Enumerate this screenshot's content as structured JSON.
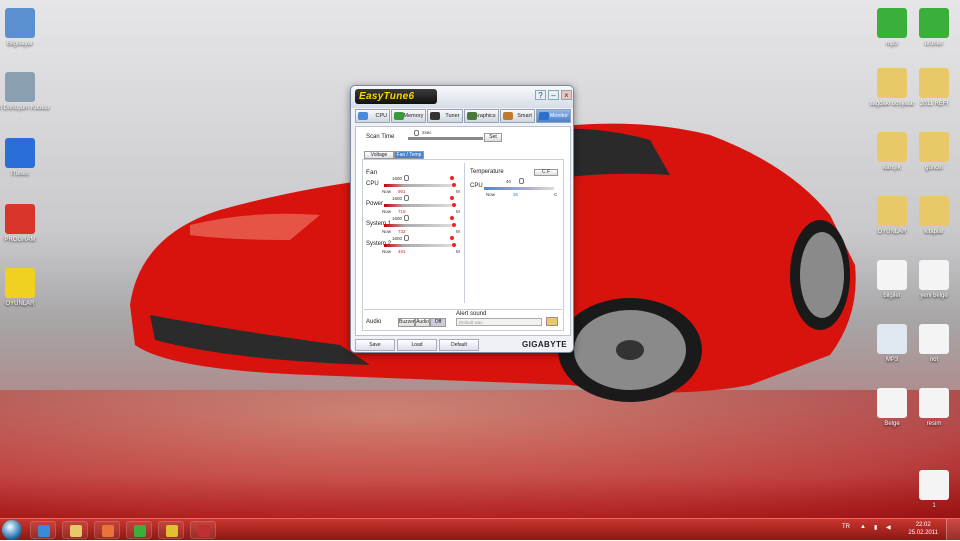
{
  "desktop_icons_left": [
    {
      "name": "computer-icon",
      "label": "Bilgisayar",
      "color": "#5b8fd0"
    },
    {
      "name": "recycle-bin-icon",
      "label": "Geri Dönüşüm Kutusu",
      "color": "#8aa0b0"
    },
    {
      "name": "itunes-icon",
      "label": "iTunes",
      "color": "#2a6fd8"
    },
    {
      "name": "program-icon",
      "label": "PROGRAM",
      "color": "#d9342a"
    },
    {
      "name": "shield-icon",
      "label": "OYUNLAR",
      "color": "#f0d020"
    }
  ],
  "desktop_icons_right": [
    {
      "name": "play-shortcut-icon",
      "label": "mp3",
      "color": "#3ab03a"
    },
    {
      "name": "arrow-shortcut-icon",
      "label": "ürünler",
      "color": "#3ab03a"
    },
    {
      "name": "folder-icon",
      "label": "sağdaki dosyalar",
      "color": "#e8c868"
    },
    {
      "name": "folder-icon",
      "label": "2011 REFİ",
      "color": "#e8c868"
    },
    {
      "name": "folder-icon",
      "label": "karışık",
      "color": "#e8c868"
    },
    {
      "name": "folder-icon",
      "label": "güncel",
      "color": "#e8c868"
    },
    {
      "name": "folder-icon",
      "label": "OYUNLAR",
      "color": "#e8c868"
    },
    {
      "name": "folder-icon",
      "label": "kitaplar",
      "color": "#e8c868"
    },
    {
      "name": "document-icon",
      "label": "bilgiler",
      "color": "#f4f4f4"
    },
    {
      "name": "document-icon",
      "label": "yeni belge",
      "color": "#f4f4f4"
    },
    {
      "name": "mp3-file-icon",
      "label": "MP3",
      "color": "#dfe7f0"
    },
    {
      "name": "document-icon",
      "label": "not",
      "color": "#f4f4f4"
    },
    {
      "name": "document-icon",
      "label": "Belge",
      "color": "#f4f4f4"
    },
    {
      "name": "image-file-icon",
      "label": "resim",
      "color": "#f4f4f4"
    },
    {
      "name": "image-file-icon",
      "label": "1",
      "color": "#f4f4f4"
    }
  ],
  "window": {
    "title": "EasyTune6",
    "tabs": [
      {
        "label": "CPU",
        "color": "#4a8ad8",
        "active": false
      },
      {
        "label": "Memory",
        "color": "#3a9a3a",
        "active": false
      },
      {
        "label": "Tuner",
        "color": "#333333",
        "active": false
      },
      {
        "label": "Graphics",
        "color": "#4a7a3a",
        "active": false
      },
      {
        "label": "Smart",
        "color": "#c07a30",
        "active": false
      },
      {
        "label": "HW Monitor",
        "color": "#2a6fc8",
        "active": true
      }
    ],
    "scan_time_label": "Scan Time",
    "scan_value": "2sec",
    "set_button": "Set",
    "subtabs": [
      "Voltage",
      "Fan / Temp"
    ],
    "fan": {
      "title": "Fan",
      "rows": [
        {
          "label": "CPU",
          "target": "1600",
          "now_label": "Now",
          "now": "901",
          "unit": "M"
        },
        {
          "label": "Power",
          "target": "1600",
          "now_label": "Now",
          "now": "719",
          "unit": "M"
        },
        {
          "label": "System 1",
          "target": "1600",
          "now_label": "Now",
          "now": "732",
          "unit": "M"
        },
        {
          "label": "System 2",
          "target": "1600",
          "now_label": "Now",
          "now": "491",
          "unit": "M"
        }
      ]
    },
    "temperature": {
      "title": "Temperature",
      "label": "CPU",
      "target": "40",
      "now_label": "Now",
      "now": "35",
      "unit": "C"
    },
    "alert_label": "Alert sound",
    "audio_label": "Audio",
    "audio_buttons": [
      "Buzzer",
      "Audio",
      "Off"
    ],
    "alert_placeholder": "Default wav",
    "footer_buttons": [
      "Save",
      "Load",
      "Default"
    ],
    "brand": "GIGABYTE"
  },
  "taskbar": {
    "items": [
      {
        "name": "ie-icon",
        "color": "#3a8ad8"
      },
      {
        "name": "folder-icon",
        "color": "#e8c868"
      },
      {
        "name": "media-player-icon",
        "color": "#e8743a"
      },
      {
        "name": "messenger-icon",
        "color": "#3ab03a"
      },
      {
        "name": "chrome-icon",
        "color": "#e0c030"
      },
      {
        "name": "easytune-icon",
        "color": "#c03030"
      }
    ],
    "lang": "TR",
    "time": "22:02",
    "date": "25.02.2011"
  }
}
